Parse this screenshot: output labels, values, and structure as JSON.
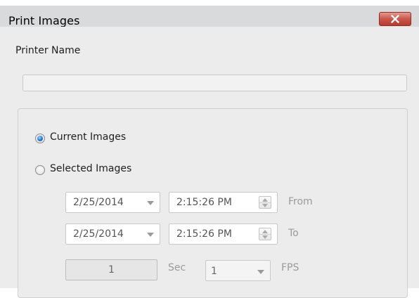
{
  "window": {
    "title": "Print Images"
  },
  "printer": {
    "label": "Printer Name",
    "value": ""
  },
  "mode": {
    "options": [
      {
        "label": "Current Images",
        "checked": true
      },
      {
        "label": "Selected Images",
        "checked": false
      }
    ]
  },
  "range": {
    "from": {
      "date": "2/25/2014",
      "time": "2:15:26 PM",
      "label": "From"
    },
    "to": {
      "date": "2/25/2014",
      "time": "2:15:26 PM",
      "label": "To"
    }
  },
  "interval": {
    "value": "1",
    "unit": "Sec"
  },
  "fps": {
    "value": "1",
    "unit": "FPS"
  },
  "colors": {
    "close_button": "#c9564a",
    "radio_checked": "#1e6fd0",
    "background": "#ececec"
  }
}
